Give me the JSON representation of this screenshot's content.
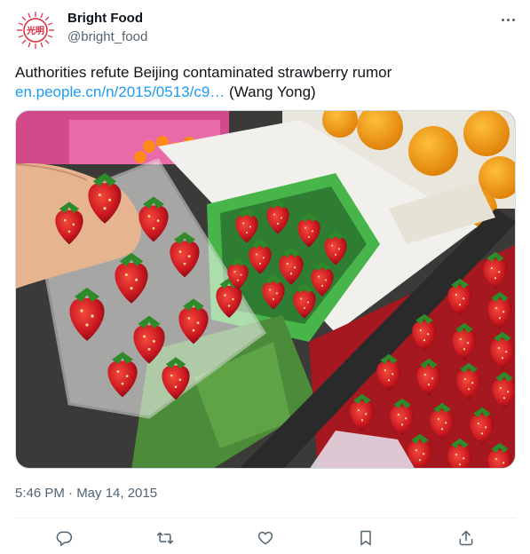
{
  "account": {
    "name": "Bright Food",
    "handle": "@bright_food",
    "avatar_icon": "bright-food-logo",
    "logo_text": "光明"
  },
  "tweet": {
    "text": "Authorities refute Beijing contaminated strawberry rumor",
    "link_text": "en.people.cn/n/2015/0513/c9…",
    "credit": " (Wang Yong)",
    "timestamp": "5:46 PM · May 14, 2015"
  },
  "actions": [
    {
      "name": "reply-icon"
    },
    {
      "name": "retweet-icon"
    },
    {
      "name": "like-icon"
    },
    {
      "name": "bookmark-icon"
    },
    {
      "name": "share-icon"
    }
  ],
  "colors": {
    "link": "#1d9bf0",
    "secondary_text": "#536471",
    "logo_red": "#d9263a"
  }
}
